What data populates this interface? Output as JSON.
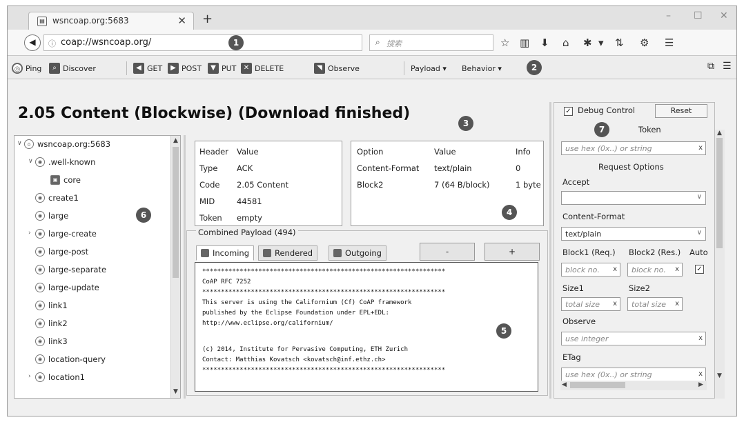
{
  "browser": {
    "tab_title": "wsncoap.org:5683",
    "tab_close": "✕",
    "new_tab": "+",
    "min": "–",
    "max": "☐",
    "close": "✕",
    "url": "coap://wsncoap.org/",
    "search_placeholder": "搜索"
  },
  "toolbar": {
    "ping": "Ping",
    "discover": "Discover",
    "get": "GET",
    "post": "POST",
    "put": "PUT",
    "delete": "DELETE",
    "observe": "Observe",
    "payload": "Payload ▾",
    "behavior": "Behavior ▾"
  },
  "badges": [
    "1",
    "2",
    "3",
    "4",
    "5",
    "6",
    "7"
  ],
  "status_title": "2.05 Content (Blockwise) (Download finished)",
  "tree": {
    "root": "wsncoap.org:5683",
    "items": [
      ".well-known",
      "core",
      "create1",
      "large",
      "large-create",
      "large-post",
      "large-separate",
      "large-update",
      "link1",
      "link2",
      "link3",
      "location-query",
      "location1"
    ]
  },
  "headers": {
    "columns": [
      "Header",
      "Value"
    ],
    "rows": [
      [
        "Type",
        "ACK"
      ],
      [
        "Code",
        "2.05 Content"
      ],
      [
        "MID",
        "44581"
      ],
      [
        "Token",
        "empty"
      ]
    ]
  },
  "options": {
    "columns": [
      "Option",
      "Value",
      "Info"
    ],
    "rows": [
      [
        "Content-Format",
        "text/plain",
        "0"
      ],
      [
        "Block2",
        "7 (64 B/block)",
        "1 byte"
      ]
    ]
  },
  "payload": {
    "label": "Combined Payload (494)",
    "tabs": [
      "Incoming",
      "Rendered",
      "Outgoing"
    ],
    "minus": "-",
    "plus": "+",
    "lines": [
      "*****************************************************************",
      "CoAP RFC 7252",
      "*****************************************************************",
      "This server is using the Californium (Cf) CoAP framework",
      "published by the Eclipse Foundation under EPL+EDL:",
      "http://www.eclipse.org/californium/",
      "",
      "(c) 2014, Institute for Pervasive Computing, ETH Zurich",
      "Contact: Matthias Kovatsch <kovatsch@inf.ethz.ch>",
      "*****************************************************************"
    ]
  },
  "debug": {
    "debug_control": "Debug Control",
    "reset": "Reset",
    "token": "Token",
    "token_placeholder": "use hex (0x..) or string",
    "request_options": "Request Options",
    "accept": "Accept",
    "content_format": "Content-Format",
    "content_format_value": "text/plain",
    "block1": "Block1 (Req.)",
    "block2": "Block2 (Res.)",
    "auto": "Auto",
    "block_placeholder": "block no.",
    "size1": "Size1",
    "size2": "Size2",
    "size_placeholder": "total size",
    "observe": "Observe",
    "observe_placeholder": "use integer",
    "etag": "ETag",
    "etag_placeholder": "use hex (0x..) or string",
    "clear": "x"
  }
}
